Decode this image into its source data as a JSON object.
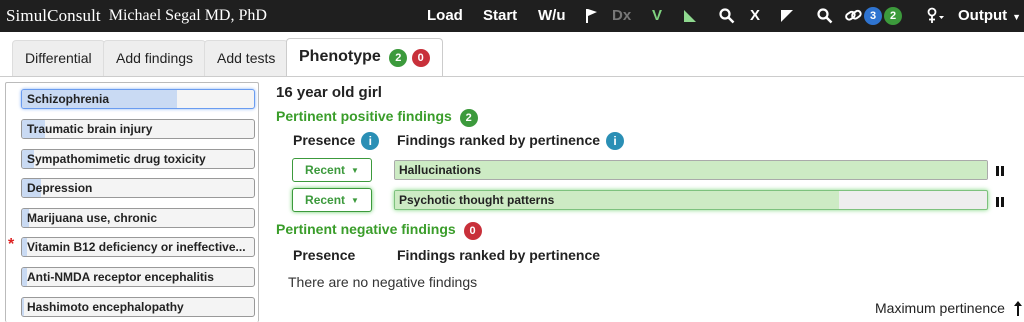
{
  "topbar": {
    "logo": "SimulConsult",
    "user": "Michael Segal MD, PhD",
    "load": "Load",
    "start": "Start",
    "wu": "W/u",
    "dx": "Dx",
    "v": "V",
    "x": "X",
    "link_blue_count": "3",
    "link_green_count": "2",
    "output": "Output"
  },
  "tabs": {
    "differential": "Differential",
    "add_findings": "Add findings",
    "add_tests": "Add tests",
    "phenotype": "Phenotype",
    "phenotype_pos_count": "2",
    "phenotype_neg_count": "0"
  },
  "differential": [
    {
      "label": "Schizophrenia",
      "fill": 0.67,
      "selected": true,
      "flag": ""
    },
    {
      "label": "Traumatic brain injury",
      "fill": 0.1,
      "selected": false,
      "flag": ""
    },
    {
      "label": "Sympathomimetic drug toxicity",
      "fill": 0.05,
      "selected": false,
      "flag": ""
    },
    {
      "label": "Depression",
      "fill": 0.08,
      "selected": false,
      "flag": ""
    },
    {
      "label": "Marijuana use, chronic",
      "fill": 0.03,
      "selected": false,
      "flag": ""
    },
    {
      "label": "Vitamin B12 deficiency or ineffective...",
      "fill": 0.02,
      "selected": false,
      "flag": "*"
    },
    {
      "label": "Anti-NMDA receptor encephalitis",
      "fill": 0.02,
      "selected": false,
      "flag": ""
    },
    {
      "label": "Hashimoto encephalopathy",
      "fill": 0.01,
      "selected": false,
      "flag": ""
    }
  ],
  "main": {
    "patient": "16 year old girl",
    "positive_title": "Pertinent positive findings",
    "positive_count": "2",
    "presence_header": "Presence",
    "findings_header": "Findings ranked by pertinence",
    "info_glyph": "i",
    "positive_findings": [
      {
        "presence": "Recent",
        "label": "Hallucinations",
        "pertinence": 1.0
      },
      {
        "presence": "Recent",
        "label": "Psychotic thought patterns",
        "pertinence": 0.75
      }
    ],
    "negative_title": "Pertinent negative findings",
    "negative_count": "0",
    "no_negative_text": "There are no negative findings",
    "max_pertinence": "Maximum pertinence"
  }
}
